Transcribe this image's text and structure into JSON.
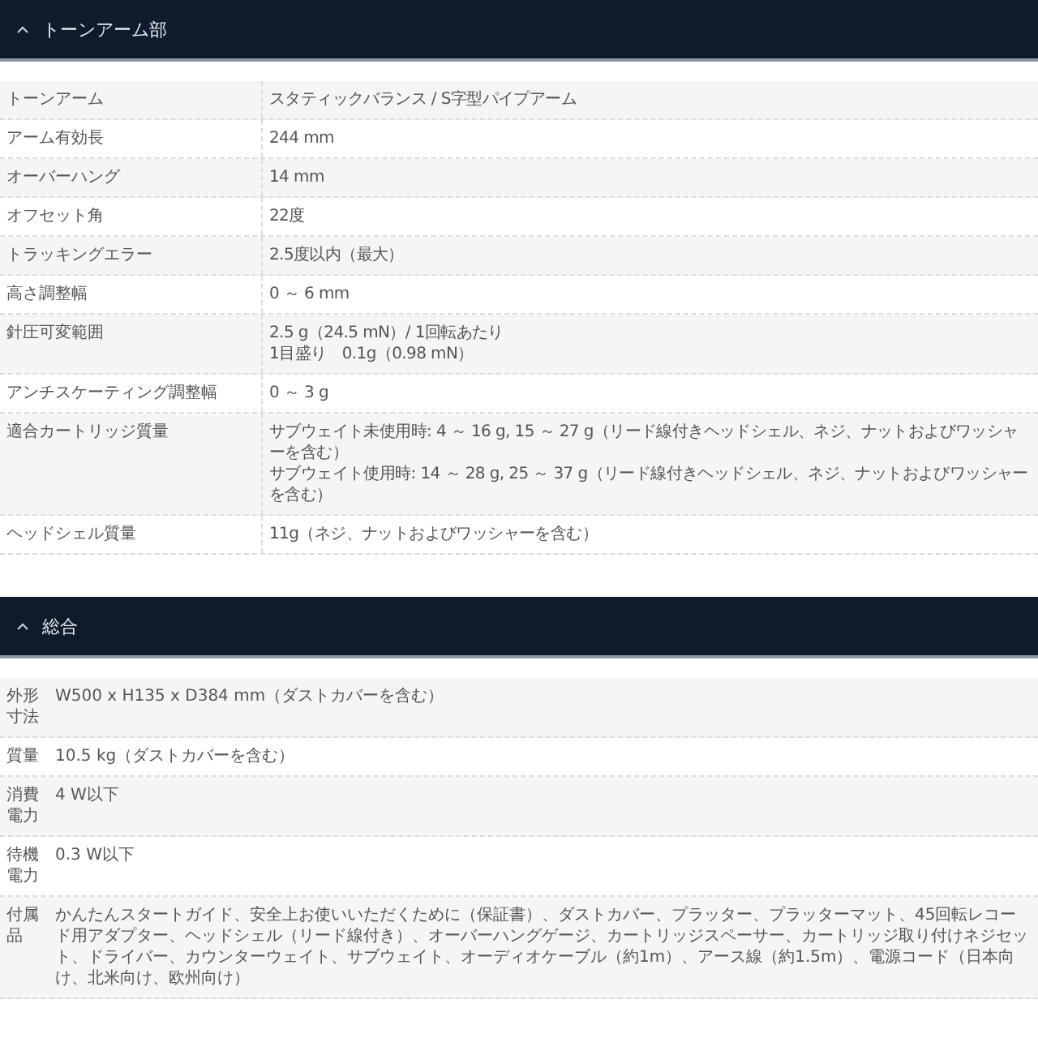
{
  "sections": [
    {
      "title": "トーンアーム部",
      "expanded": true,
      "kind": "wide",
      "rows": [
        {
          "label": "トーンアーム",
          "lines": [
            "スタティックバランス / S字型パイプアーム"
          ]
        },
        {
          "label": "アーム有効長",
          "lines": [
            "244 mm"
          ]
        },
        {
          "label": "オーバーハング",
          "lines": [
            "14 mm"
          ]
        },
        {
          "label": "オフセット角",
          "lines": [
            "22度"
          ]
        },
        {
          "label": "トラッキングエラー",
          "lines": [
            "2.5度以内（最大）"
          ]
        },
        {
          "label": "高さ調整幅",
          "lines": [
            "0 ～ 6 mm"
          ]
        },
        {
          "label": "針圧可変範囲",
          "lines": [
            "2.5 g（24.5 mN）/ 1回転あたり",
            "1目盛り　0.1g（0.98 mN）"
          ]
        },
        {
          "label": "アンチスケーティング調整幅",
          "lines": [
            "0 ～ 3 g"
          ]
        },
        {
          "label": "適合カートリッジ質量",
          "lines": [
            "サブウェイト未使用時: 4 ～ 16 g, 15 ～ 27 g（リード線付きヘッドシェル、ネジ、ナットおよびワッシャーを含む）",
            "サブウェイト使用時: 14 ～ 28 g, 25 ～ 37 g（リード線付きヘッドシェル、ネジ、ナットおよびワッシャーを含む）"
          ]
        },
        {
          "label": "ヘッドシェル質量",
          "lines": [
            "11g（ネジ、ナットおよびワッシャーを含む）"
          ]
        }
      ]
    },
    {
      "title": "総合",
      "expanded": true,
      "kind": "narrow",
      "rows": [
        {
          "label": "外形寸法",
          "lines": [
            "W500 x H135 x D384 mm（ダストカバーを含む）"
          ]
        },
        {
          "label": "質量",
          "lines": [
            "10.5 kg（ダストカバーを含む）"
          ]
        },
        {
          "label": "消費電力",
          "lines": [
            "4 W以下"
          ]
        },
        {
          "label": "待機電力",
          "lines": [
            "0.3 W以下"
          ]
        },
        {
          "label": "付属品",
          "lines": [
            "かんたんスタートガイド、安全上お使いいただくために（保証書）、ダストカバー、プラッター、プラッターマット、45回転レコード用アダプター、ヘッドシェル（リード線付き）、オーバーハングゲージ、カートリッジスペーサー、カートリッジ取り付けネジセット、ドライバー、カウンターウェイト、サブウェイト、オーディオケーブル（約1m）、アース線（約1.5m）、電源コード（日本向け、北米向け、欧州向け）"
          ]
        }
      ]
    }
  ]
}
